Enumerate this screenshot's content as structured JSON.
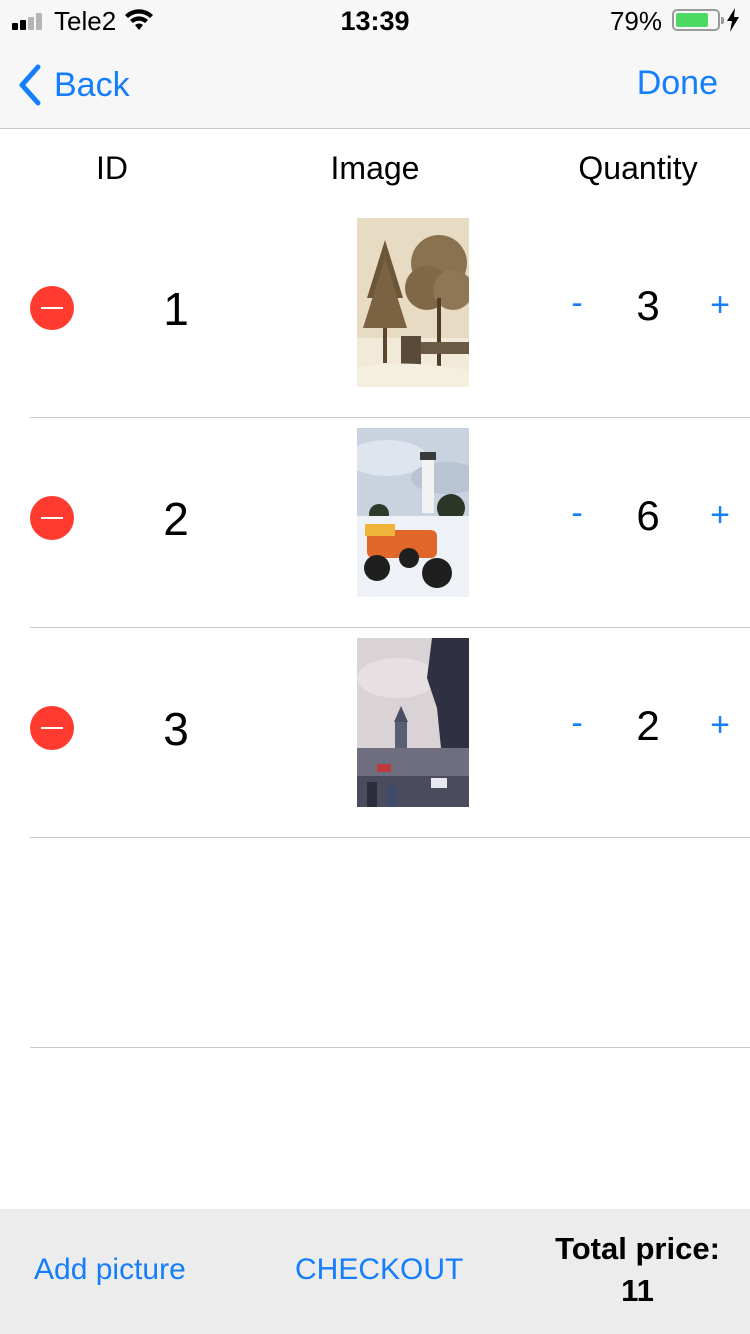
{
  "status_bar": {
    "carrier": "Tele2",
    "time": "13:39",
    "battery_percent": "79%",
    "battery_level": 0.79,
    "signal_bars": 2,
    "charging": true
  },
  "nav": {
    "back_label": "Back",
    "done_label": "Done",
    "tint_color": "#147efb"
  },
  "columns": {
    "id": "ID",
    "image": "Image",
    "quantity": "Quantity"
  },
  "rows": [
    {
      "id": "1",
      "image": "snowy-sepia-trees-photo",
      "minus": "-",
      "quantity": "3",
      "plus": "+"
    },
    {
      "id": "2",
      "image": "lighthouse-atv-snow-photo",
      "minus": "-",
      "quantity": "6",
      "plus": "+"
    },
    {
      "id": "3",
      "image": "city-clock-tower-street-photo",
      "minus": "-",
      "quantity": "2",
      "plus": "+"
    }
  ],
  "toolbar": {
    "add_picture": "Add picture",
    "checkout": "CHECKOUT",
    "total_label": "Total price:",
    "total_value": "11"
  },
  "colors": {
    "delete_red": "#ff3b30",
    "accent_blue": "#147efb",
    "battery_green": "#4cd964"
  }
}
